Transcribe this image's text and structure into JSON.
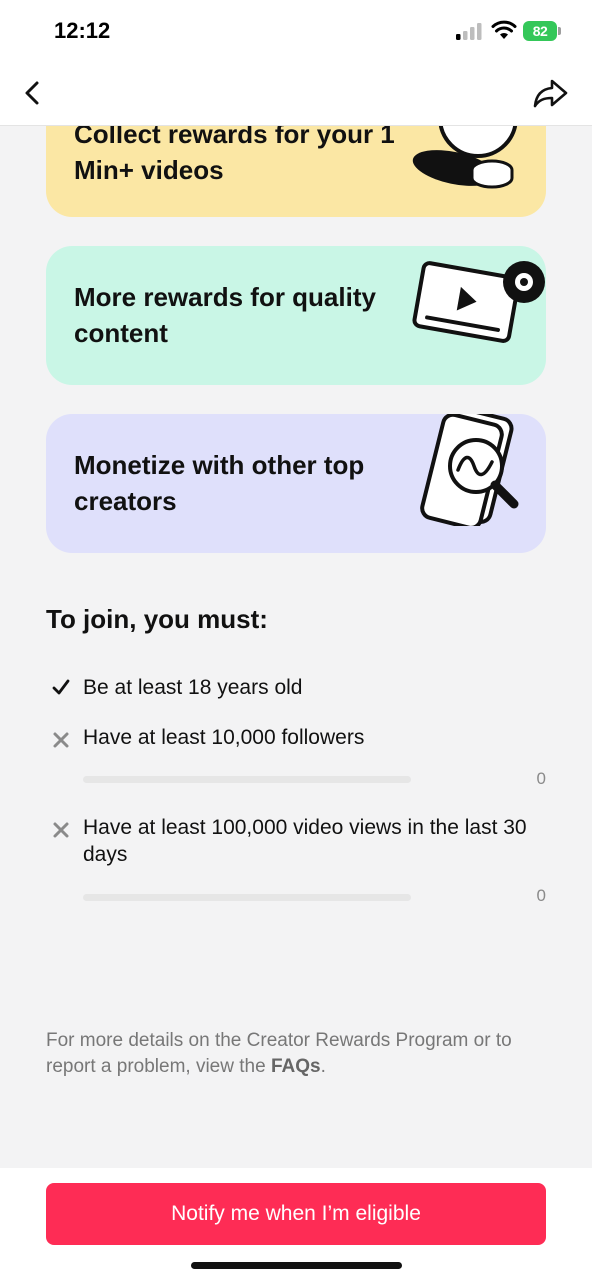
{
  "status_bar": {
    "time": "12:12",
    "battery": "82"
  },
  "nav": {
    "back_icon": "chevron-left-icon",
    "share_icon": "share-arrow-icon"
  },
  "cards": [
    {
      "title": "Collect rewards for your 1 Min+ videos",
      "color": "#fbe7a4",
      "icon": "coin-icon"
    },
    {
      "title": "More rewards for quality content",
      "color": "#c9f6e6",
      "icon": "video-eye-icon"
    },
    {
      "title": "Monetize with other top creators",
      "color": "#dfe0fb",
      "icon": "phone-search-icon"
    }
  ],
  "requirements": {
    "heading": "To join, you must:",
    "items": [
      {
        "text": "Be at least 18 years old",
        "met": true,
        "icon": "check-icon"
      },
      {
        "text": "Have at least 10,000 followers",
        "met": false,
        "icon": "x-icon",
        "progress_count": "0",
        "progress_fraction": 0
      },
      {
        "text": "Have at least 100,000 video views in the last 30 days",
        "met": false,
        "icon": "x-icon",
        "progress_count": "0",
        "progress_fraction": 0
      }
    ]
  },
  "footer": {
    "text_before": "For more details on the Creator Rewards Program or to report a problem, view the ",
    "link_text": "FAQs",
    "text_after": "."
  },
  "cta": {
    "label": "Notify me when I’m eligible",
    "color": "#fe2c55"
  }
}
